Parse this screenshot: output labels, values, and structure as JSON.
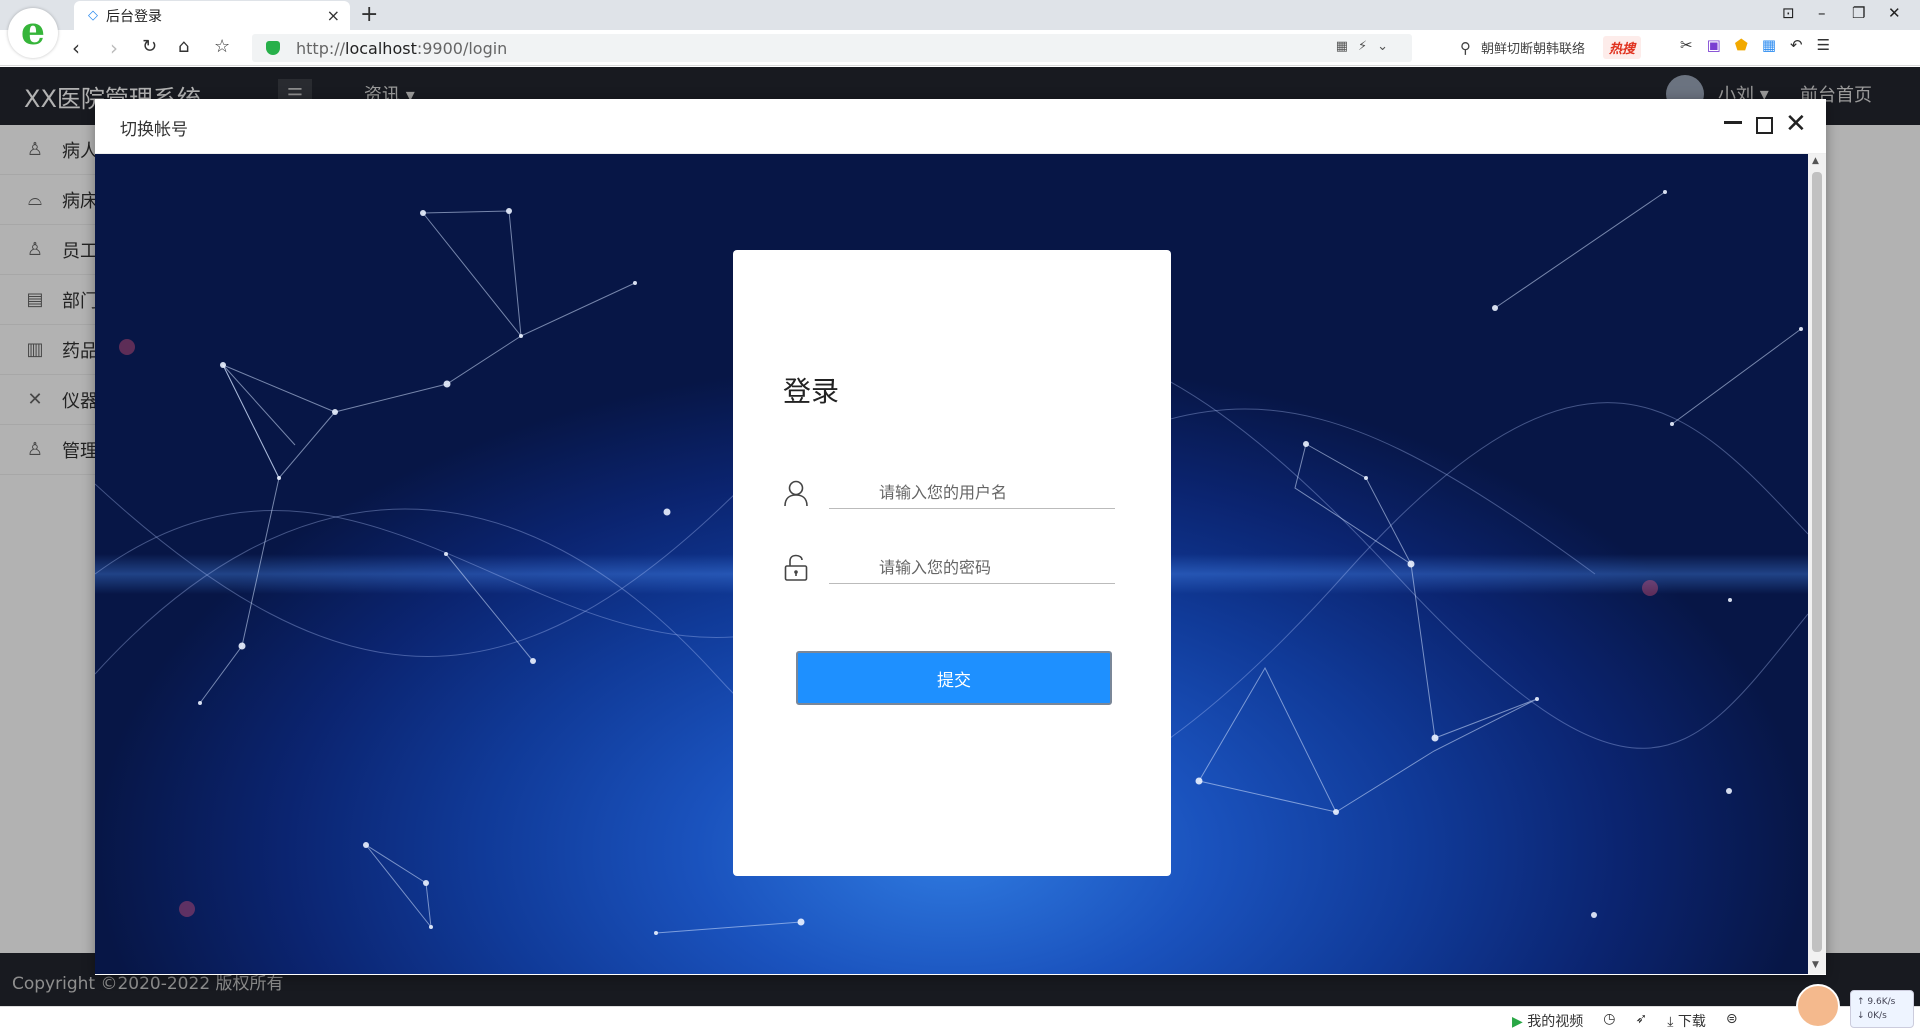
{
  "browser": {
    "tab_title": "后台登录",
    "url_prefix": "http://",
    "url_host": "localhost",
    "url_rest": ":9900/login",
    "search_text": "朝鲜切断朝韩联络",
    "hot_label": "热搜"
  },
  "app": {
    "title": "XX医院管理系统",
    "info_menu": "资讯",
    "user_name": "小刘",
    "front_home": "前台首页",
    "sidebar": [
      {
        "label": "病人",
        "icon": "user-icon"
      },
      {
        "label": "病床",
        "icon": "sofa-icon"
      },
      {
        "label": "员工",
        "icon": "staff-icon"
      },
      {
        "label": "部门",
        "icon": "table-icon"
      },
      {
        "label": "药品",
        "icon": "clipboard-icon"
      },
      {
        "label": "仪器",
        "icon": "tools-icon"
      },
      {
        "label": "管理",
        "icon": "admin-icon"
      }
    ],
    "footer": "Copyright ©2020-2022 版权所有"
  },
  "modal": {
    "title": "切换帐号"
  },
  "login": {
    "title": "登录",
    "username_placeholder": "请输入您的用户名",
    "password_placeholder": "请输入您的密码",
    "submit_label": "提交"
  },
  "statusbar": {
    "my_video": "我的视频",
    "download": "下载"
  },
  "speed": {
    "up": "9.6K/s",
    "down": "0K/s"
  },
  "colors": {
    "accent_button": "#1e90ff",
    "header_dark": "#23262e"
  }
}
